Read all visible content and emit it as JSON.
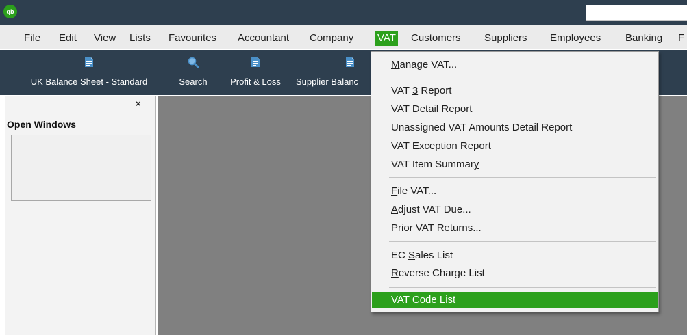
{
  "app": {
    "logo_text": "qb",
    "search_placeholder": ""
  },
  "menu": {
    "file": {
      "mnemonic": "F",
      "rest": "ile"
    },
    "edit": {
      "mnemonic": "E",
      "rest": "dit"
    },
    "view": {
      "mnemonic": "V",
      "rest": "iew"
    },
    "lists": {
      "pre": "",
      "mnemonic": "L",
      "rest": "ists"
    },
    "favourites": "Favourites",
    "accountant": "Accountant",
    "company": {
      "mnemonic": "C",
      "rest": "ompany"
    },
    "vat": "VAT",
    "customers": {
      "pre": "C",
      "mnemonic": "u",
      "rest": "stomers"
    },
    "suppliers": {
      "pre": "Suppl",
      "mnemonic": "i",
      "rest": "ers"
    },
    "employees": {
      "pre": "Emplo",
      "mnemonic": "y",
      "rest": "ees"
    },
    "banking": {
      "mnemonic": "B",
      "rest": "anking"
    },
    "overflow": {
      "mnemonic": "F",
      "rest": ""
    }
  },
  "toolbar": {
    "items": [
      {
        "label": "UK Balance Sheet - Standard",
        "icon": "report-icon"
      },
      {
        "label": "Search",
        "icon": "search-icon"
      },
      {
        "label": "Profit & Loss",
        "icon": "report-icon"
      },
      {
        "label": "Supplier Balanc",
        "icon": "report-icon"
      }
    ]
  },
  "sidepanel": {
    "close": "×",
    "title": "Open Windows"
  },
  "vat_menu": {
    "manage_vat": {
      "pre": "",
      "mnemonic": "M",
      "rest": "anage VAT..."
    },
    "vat3_report": {
      "pre": "VAT ",
      "mnemonic": "3",
      "rest": " Report"
    },
    "vat_detail": {
      "pre": "VAT ",
      "mnemonic": "D",
      "rest": "etail Report"
    },
    "unassigned": "Unassigned VAT Amounts Detail Report",
    "exception": "VAT Exception Report",
    "item_summary": {
      "pre": "VAT Item Summar",
      "mnemonic": "y",
      "rest": ""
    },
    "file_vat": {
      "pre": "",
      "mnemonic": "F",
      "rest": "ile VAT..."
    },
    "adjust_vat": {
      "pre": "",
      "mnemonic": "A",
      "rest": "djust VAT Due..."
    },
    "prior_returns": {
      "pre": "",
      "mnemonic": "P",
      "rest": "rior VAT Returns..."
    },
    "ec_sales": {
      "pre": "EC ",
      "mnemonic": "S",
      "rest": "ales List"
    },
    "reverse_charge": {
      "pre": "",
      "mnemonic": "R",
      "rest": "everse Charge List"
    },
    "vat_code_list": {
      "pre": "",
      "mnemonic": "V",
      "rest": "AT Code List"
    }
  },
  "colors": {
    "accent_green": "#2ca01c",
    "title_bar": "#2e3f4f",
    "workspace": "#808080"
  }
}
